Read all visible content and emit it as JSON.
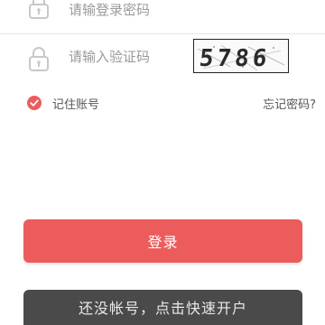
{
  "password_field": {
    "placeholder": "请输登录密码",
    "icon": "lock-icon"
  },
  "captcha_field": {
    "placeholder": "请输入验证码",
    "icon": "lock-icon",
    "captcha_text": "5786"
  },
  "remember": {
    "label": "记住账号",
    "checked": true,
    "icon": "check-circle-icon"
  },
  "forgot_password": "忘记密码?",
  "buttons": {
    "login": "登录",
    "register": "还没帐号，点击快速开户"
  },
  "colors": {
    "accent": "#ec5c5c",
    "register_bg": "#4a4a4a",
    "icon_gray": "#c8c8c8"
  }
}
